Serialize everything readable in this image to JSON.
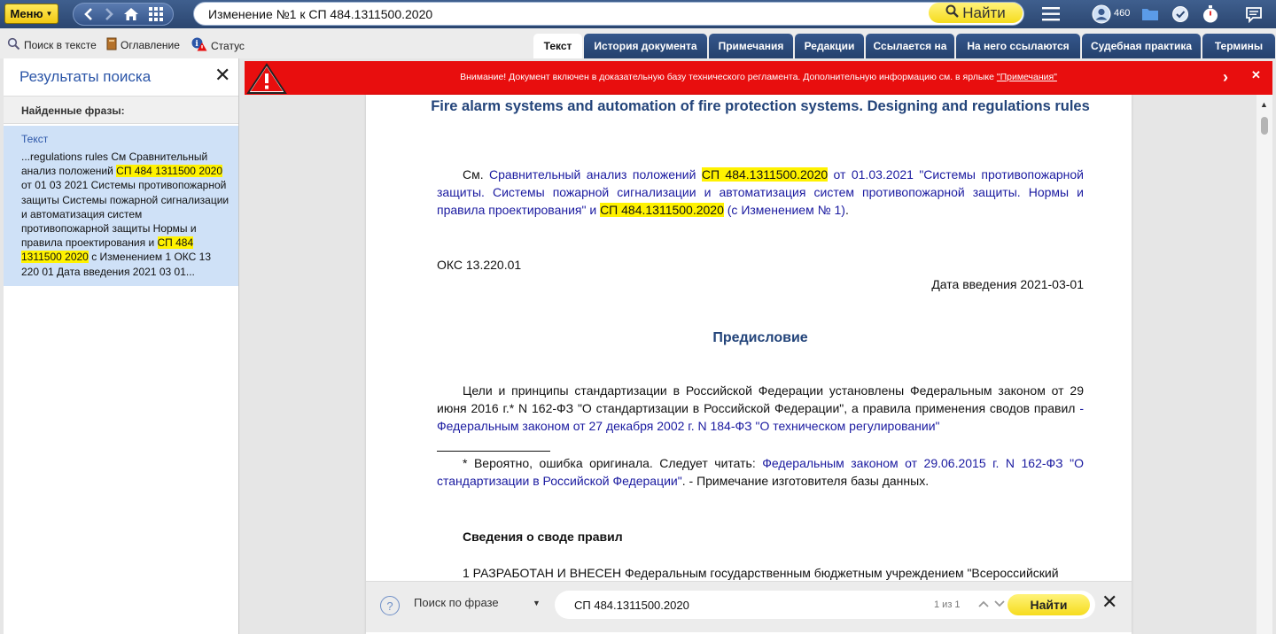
{
  "topbar": {
    "menu_label": "Меню",
    "search_value": "Изменение №1 к СП 484.1311500.2020",
    "find_label": "Найти",
    "counter": "460"
  },
  "toolbar": {
    "search_in_text": "Поиск в тексте",
    "contents": "Оглавление",
    "status": "Статус"
  },
  "tabs": [
    {
      "label": "Текст",
      "active": true
    },
    {
      "label": "История документа"
    },
    {
      "label": "Примечания"
    },
    {
      "label": "Редакции"
    },
    {
      "label": "Ссылается на"
    },
    {
      "label": "На него ссылаются"
    },
    {
      "label": "Судебная практика"
    },
    {
      "label": "Термины"
    }
  ],
  "sidebar": {
    "title": "Результаты поиска",
    "found_phrases": "Найденные фразы:",
    "result": {
      "label": "Текст",
      "t1": "...regulations rules См Сравнительный анализ положений ",
      "h1": "СП 484 1311500 2020",
      "t2": " от 01 03 2021 Системы противопожарной защиты Системы пожарной сигнализации и автоматизация систем противопожарной защиты Нормы и правила проектирования и ",
      "h2": "СП 484 1311500 2020",
      "t3": " с Изменением 1 ОКС 13 220 01 Дата введения 2021 03 01..."
    }
  },
  "banner": {
    "text": "Внимание! Документ включен в доказательную базу технического регламента. Дополнительную информацию см. в ярлыке ",
    "link": "\"Примечания\""
  },
  "doc": {
    "title": "Fire alarm systems and automation of fire protection systems. Designing and regulations rules",
    "see": {
      "prefix": "См. ",
      "l1": "Сравнительный анализ положений ",
      "hl1": "СП 484.1311500.2020",
      "l2": " от 01.03.2021 \"Системы противопожарной защиты. Системы пожарной сигнализации и автоматизация систем противопожарной защиты. Нормы и правила проектирования\" и ",
      "hl2": "СП 484.1311500.2020",
      "l3": " (с Изменением № 1)",
      "suffix": "."
    },
    "oks": "ОКС 13.220.01",
    "date": "Дата введения 2021-03-01",
    "preface_heading": "Предисловие",
    "preface": {
      "text": "Цели и принципы стандартизации в Российской Федерации установлены Федеральным законом от 29 июня 2016 г.* N 162-ФЗ \"О стандартизации в Российской Федерации\", а правила применения сводов правил ",
      "link": "- Федеральным законом от 27 декабря 2002 г. N 184-ФЗ \"О техническом регулировании\""
    },
    "footnote": {
      "prefix": "* Вероятно, ошибка оригинала. Следует читать: ",
      "link": "Федеральным законом от 29.06.2015 г. N 162-ФЗ \"О стандартизации в Российской Федерации\"",
      "suffix": ". - Примечание изготовителя базы данных."
    },
    "info_heading": "Сведения о своде правил",
    "item1": "1 РАЗРАБОТАН И ВНЕСЕН Федеральным государственным бюджетным учреждением \"Всероссийский"
  },
  "findbar": {
    "help": "?",
    "mode": "Поиск по фразе",
    "value": "СП 484.1311500.2020",
    "count": "1 из 1",
    "find_label": "Найти"
  },
  "colors": {
    "accent": "#2c56a8",
    "banner": "#e80e0e",
    "highlight": "#fff200",
    "tab": "#24416d"
  }
}
